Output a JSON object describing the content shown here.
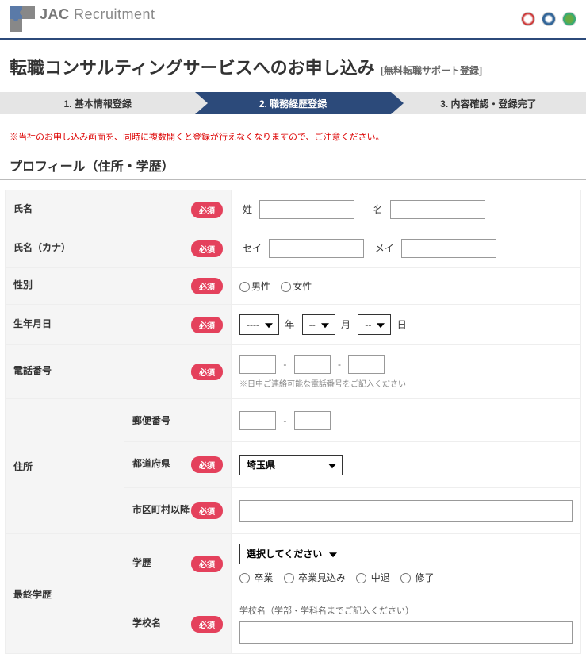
{
  "header": {
    "logo_text_1": "JAC",
    "logo_text_2": " Recruitment"
  },
  "title": {
    "main": "転職コンサルティングサービスへのお申し込み",
    "sub": "[無料転職サポート登録]"
  },
  "steps": {
    "s1": "1. 基本情報登録",
    "s2": "2. 職務経歴登録",
    "s3": "3. 内容確認・登録完了"
  },
  "warning": "※当社のお申し込み画面を、同時に複数開くと登録が行えなくなりますので、ご注意ください。",
  "section_title": "プロフィール（住所・学歴）",
  "labels": {
    "required": "必須",
    "name": "氏名",
    "name_kana": "氏名（カナ）",
    "gender": "性別",
    "birthdate": "生年月日",
    "phone": "電話番号",
    "address": "住所",
    "postal": "郵便番号",
    "prefecture": "都道府県",
    "city": "市区町村以降",
    "education": "最終学歴",
    "degree": "学歴",
    "school": "学校名",
    "sei": "姓",
    "mei": "名",
    "sei_kana": "セイ",
    "mei_kana": "メイ",
    "male": "男性",
    "female": "女性",
    "year": "年",
    "month": "月",
    "day": "日",
    "sotsugyo": "卒業",
    "mikomi": "卒業見込み",
    "chutai": "中退",
    "shuryo": "修了"
  },
  "placeholders": {
    "year_default": "----",
    "md_default": "--",
    "prefecture_default": "埼玉県",
    "degree_default": "選択してください"
  },
  "notes": {
    "phone": "※日中ご連絡可能な電話番号をご記入ください",
    "school": "学校名（学部・学科名までご記入ください）"
  }
}
